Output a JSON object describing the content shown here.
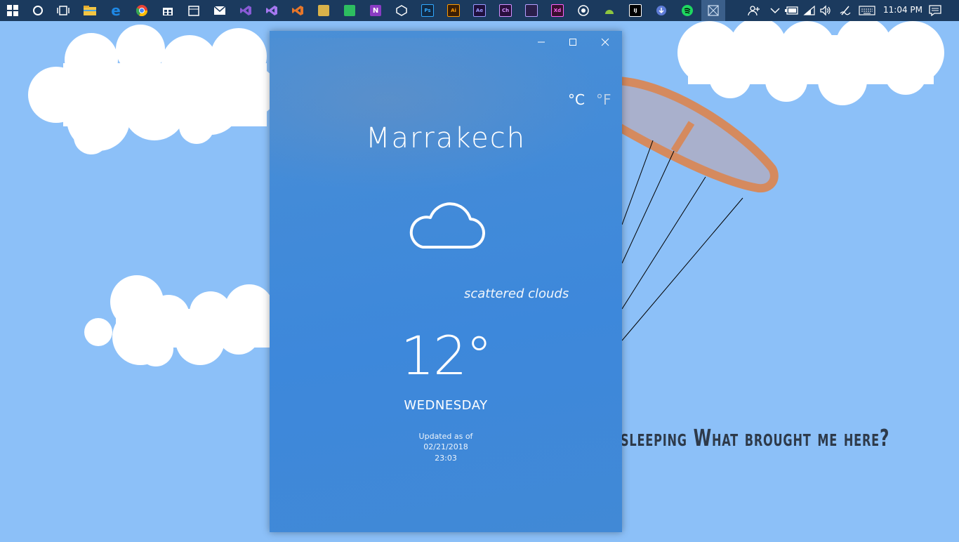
{
  "taskbar": {
    "apps": [
      {
        "name": "windows-start-icon",
        "glyph": "",
        "color": "#ffffff"
      },
      {
        "name": "cortana-icon",
        "glyph": "",
        "color": "#ffffff"
      },
      {
        "name": "task-view-icon",
        "glyph": "",
        "color": "#ffffff"
      },
      {
        "name": "file-explorer-icon",
        "glyph": "",
        "color": "#f4c542"
      },
      {
        "name": "edge-icon",
        "glyph": "e",
        "color": "#1e88e5"
      },
      {
        "name": "chrome-icon",
        "glyph": "",
        "color": "#e94335"
      },
      {
        "name": "store-icon",
        "glyph": "",
        "color": "#ffffff"
      },
      {
        "name": "calendar-icon",
        "glyph": "",
        "color": "#ffffff"
      },
      {
        "name": "mail-icon",
        "glyph": "",
        "color": "#ffffff"
      },
      {
        "name": "visual-studio-icon",
        "glyph": "",
        "color": "#8a5bd6"
      },
      {
        "name": "visual-studio-2-icon",
        "glyph": "",
        "color": "#a678f0"
      },
      {
        "name": "vscode-icon",
        "glyph": "",
        "color": "#e6762a"
      },
      {
        "name": "paint-icon",
        "glyph": "",
        "color": "#d9b24a"
      },
      {
        "name": "evernote-icon",
        "glyph": "",
        "color": "#2dbe60"
      },
      {
        "name": "onenote-icon",
        "glyph": "N",
        "color": "#8a3cc4"
      },
      {
        "name": "unity-icon",
        "glyph": "",
        "color": "#ffffff"
      },
      {
        "name": "photoshop-icon",
        "glyph": "Ps",
        "color": "#0f2a47"
      },
      {
        "name": "illustrator-icon",
        "glyph": "Ai",
        "color": "#3a1e06"
      },
      {
        "name": "after-effects-icon",
        "glyph": "Ae",
        "color": "#1f0f3d"
      },
      {
        "name": "character-animator-icon",
        "glyph": "Ch",
        "color": "#2a0f3d"
      },
      {
        "name": "premiere-icon",
        "glyph": "",
        "color": "#2a1f4a"
      },
      {
        "name": "xd-icon",
        "glyph": "Xd",
        "color": "#3a0f2e"
      },
      {
        "name": "cinema4d-icon",
        "glyph": "",
        "color": "#ffffff"
      },
      {
        "name": "android-studio-icon",
        "glyph": "",
        "color": "#8ec63f"
      },
      {
        "name": "intellij-icon",
        "glyph": "",
        "color": "#000000"
      },
      {
        "name": "download-icon",
        "glyph": "",
        "color": "#5d7bd6"
      },
      {
        "name": "spotify-icon",
        "glyph": "",
        "color": "#1ed760"
      },
      {
        "name": "active-app-icon",
        "glyph": "",
        "color": "#5a7ea8"
      }
    ],
    "clock": "11:04 PM"
  },
  "wallpaper": {
    "caption": "sleeping What brought me here?"
  },
  "weather": {
    "unit_celsius": "°C",
    "unit_fahrenheit": "°F",
    "city": "Marrakech",
    "icon": "cloud-icon",
    "description": "scattered clouds",
    "temperature": "12°",
    "day": "WEDNESDAY",
    "updated_label": "Updated as of",
    "updated_date": "02/21/2018",
    "updated_time": "23:03"
  }
}
